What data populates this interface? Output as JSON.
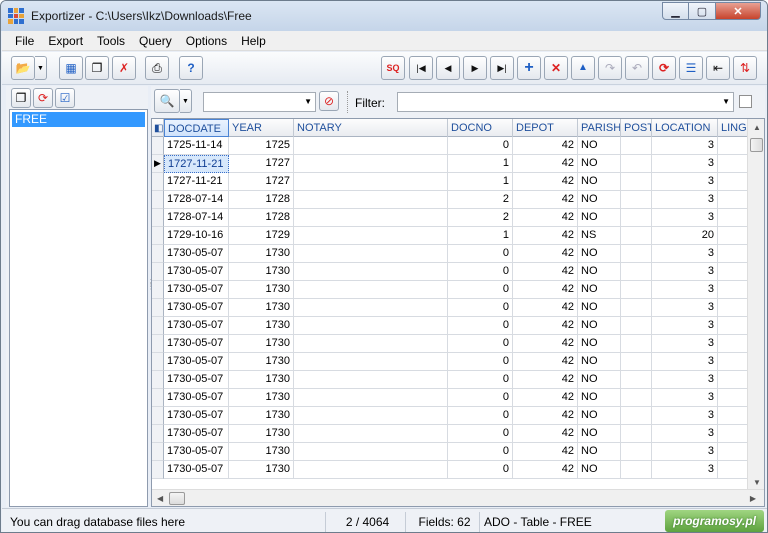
{
  "window": {
    "title": "Exportizer - C:\\Users\\Ikz\\Downloads\\Free"
  },
  "menu": [
    "File",
    "Export",
    "Tools",
    "Query",
    "Options",
    "Help"
  ],
  "left_list": {
    "items": [
      "FREE"
    ]
  },
  "filter": {
    "label": "Filter:",
    "search_value": "",
    "filter_value": ""
  },
  "grid": {
    "columns": [
      "DOCDATE",
      "YEAR",
      "NOTARY",
      "DOCNO",
      "DEPOT",
      "PARISH",
      "POST",
      "LOCATION",
      "LING"
    ],
    "rows": [
      [
        "1725-11-14",
        "1725",
        "",
        "0",
        "42",
        "NO",
        "",
        "3"
      ],
      [
        "1727-11-21",
        "1727",
        "",
        "1",
        "42",
        "NO",
        "",
        "3"
      ],
      [
        "1727-11-21",
        "1727",
        "",
        "1",
        "42",
        "NO",
        "",
        "3"
      ],
      [
        "1728-07-14",
        "1728",
        "",
        "2",
        "42",
        "NO",
        "",
        "3"
      ],
      [
        "1728-07-14",
        "1728",
        "",
        "2",
        "42",
        "NO",
        "",
        "3"
      ],
      [
        "1729-10-16",
        "1729",
        "",
        "1",
        "42",
        "NS",
        "",
        "20"
      ],
      [
        "1730-05-07",
        "1730",
        "",
        "0",
        "42",
        "NO",
        "",
        "3"
      ],
      [
        "1730-05-07",
        "1730",
        "",
        "0",
        "42",
        "NO",
        "",
        "3"
      ],
      [
        "1730-05-07",
        "1730",
        "",
        "0",
        "42",
        "NO",
        "",
        "3"
      ],
      [
        "1730-05-07",
        "1730",
        "",
        "0",
        "42",
        "NO",
        "",
        "3"
      ],
      [
        "1730-05-07",
        "1730",
        "",
        "0",
        "42",
        "NO",
        "",
        "3"
      ],
      [
        "1730-05-07",
        "1730",
        "",
        "0",
        "42",
        "NO",
        "",
        "3"
      ],
      [
        "1730-05-07",
        "1730",
        "",
        "0",
        "42",
        "NO",
        "",
        "3"
      ],
      [
        "1730-05-07",
        "1730",
        "",
        "0",
        "42",
        "NO",
        "",
        "3"
      ],
      [
        "1730-05-07",
        "1730",
        "",
        "0",
        "42",
        "NO",
        "",
        "3"
      ],
      [
        "1730-05-07",
        "1730",
        "",
        "0",
        "42",
        "NO",
        "",
        "3"
      ],
      [
        "1730-05-07",
        "1730",
        "",
        "0",
        "42",
        "NO",
        "",
        "3"
      ],
      [
        "1730-05-07",
        "1730",
        "",
        "0",
        "42",
        "NO",
        "",
        "3"
      ],
      [
        "1730-05-07",
        "1730",
        "",
        "0",
        "42",
        "NO",
        "",
        "3"
      ]
    ],
    "current_row": 1
  },
  "status": {
    "hint": "You can drag database files here",
    "record": "2 / 4064",
    "fields": "Fields: 62",
    "source": "ADO - Table - FREE"
  },
  "watermark": "programosy.pl",
  "icons": {
    "main_toolbar": [
      "open-folder-icon",
      "dropdown-arrow-icon",
      "grid-icon",
      "copy-icon",
      "clear-icon",
      "print-icon",
      "help-icon",
      "sql-icon",
      "first-record-icon",
      "prior-record-icon",
      "next-record-icon",
      "last-record-icon",
      "insert-icon",
      "delete-icon",
      "edit-icon",
      "post-icon",
      "cancel-icon",
      "refresh-icon",
      "columns-icon",
      "freeze-icon",
      "sort-icon"
    ]
  }
}
